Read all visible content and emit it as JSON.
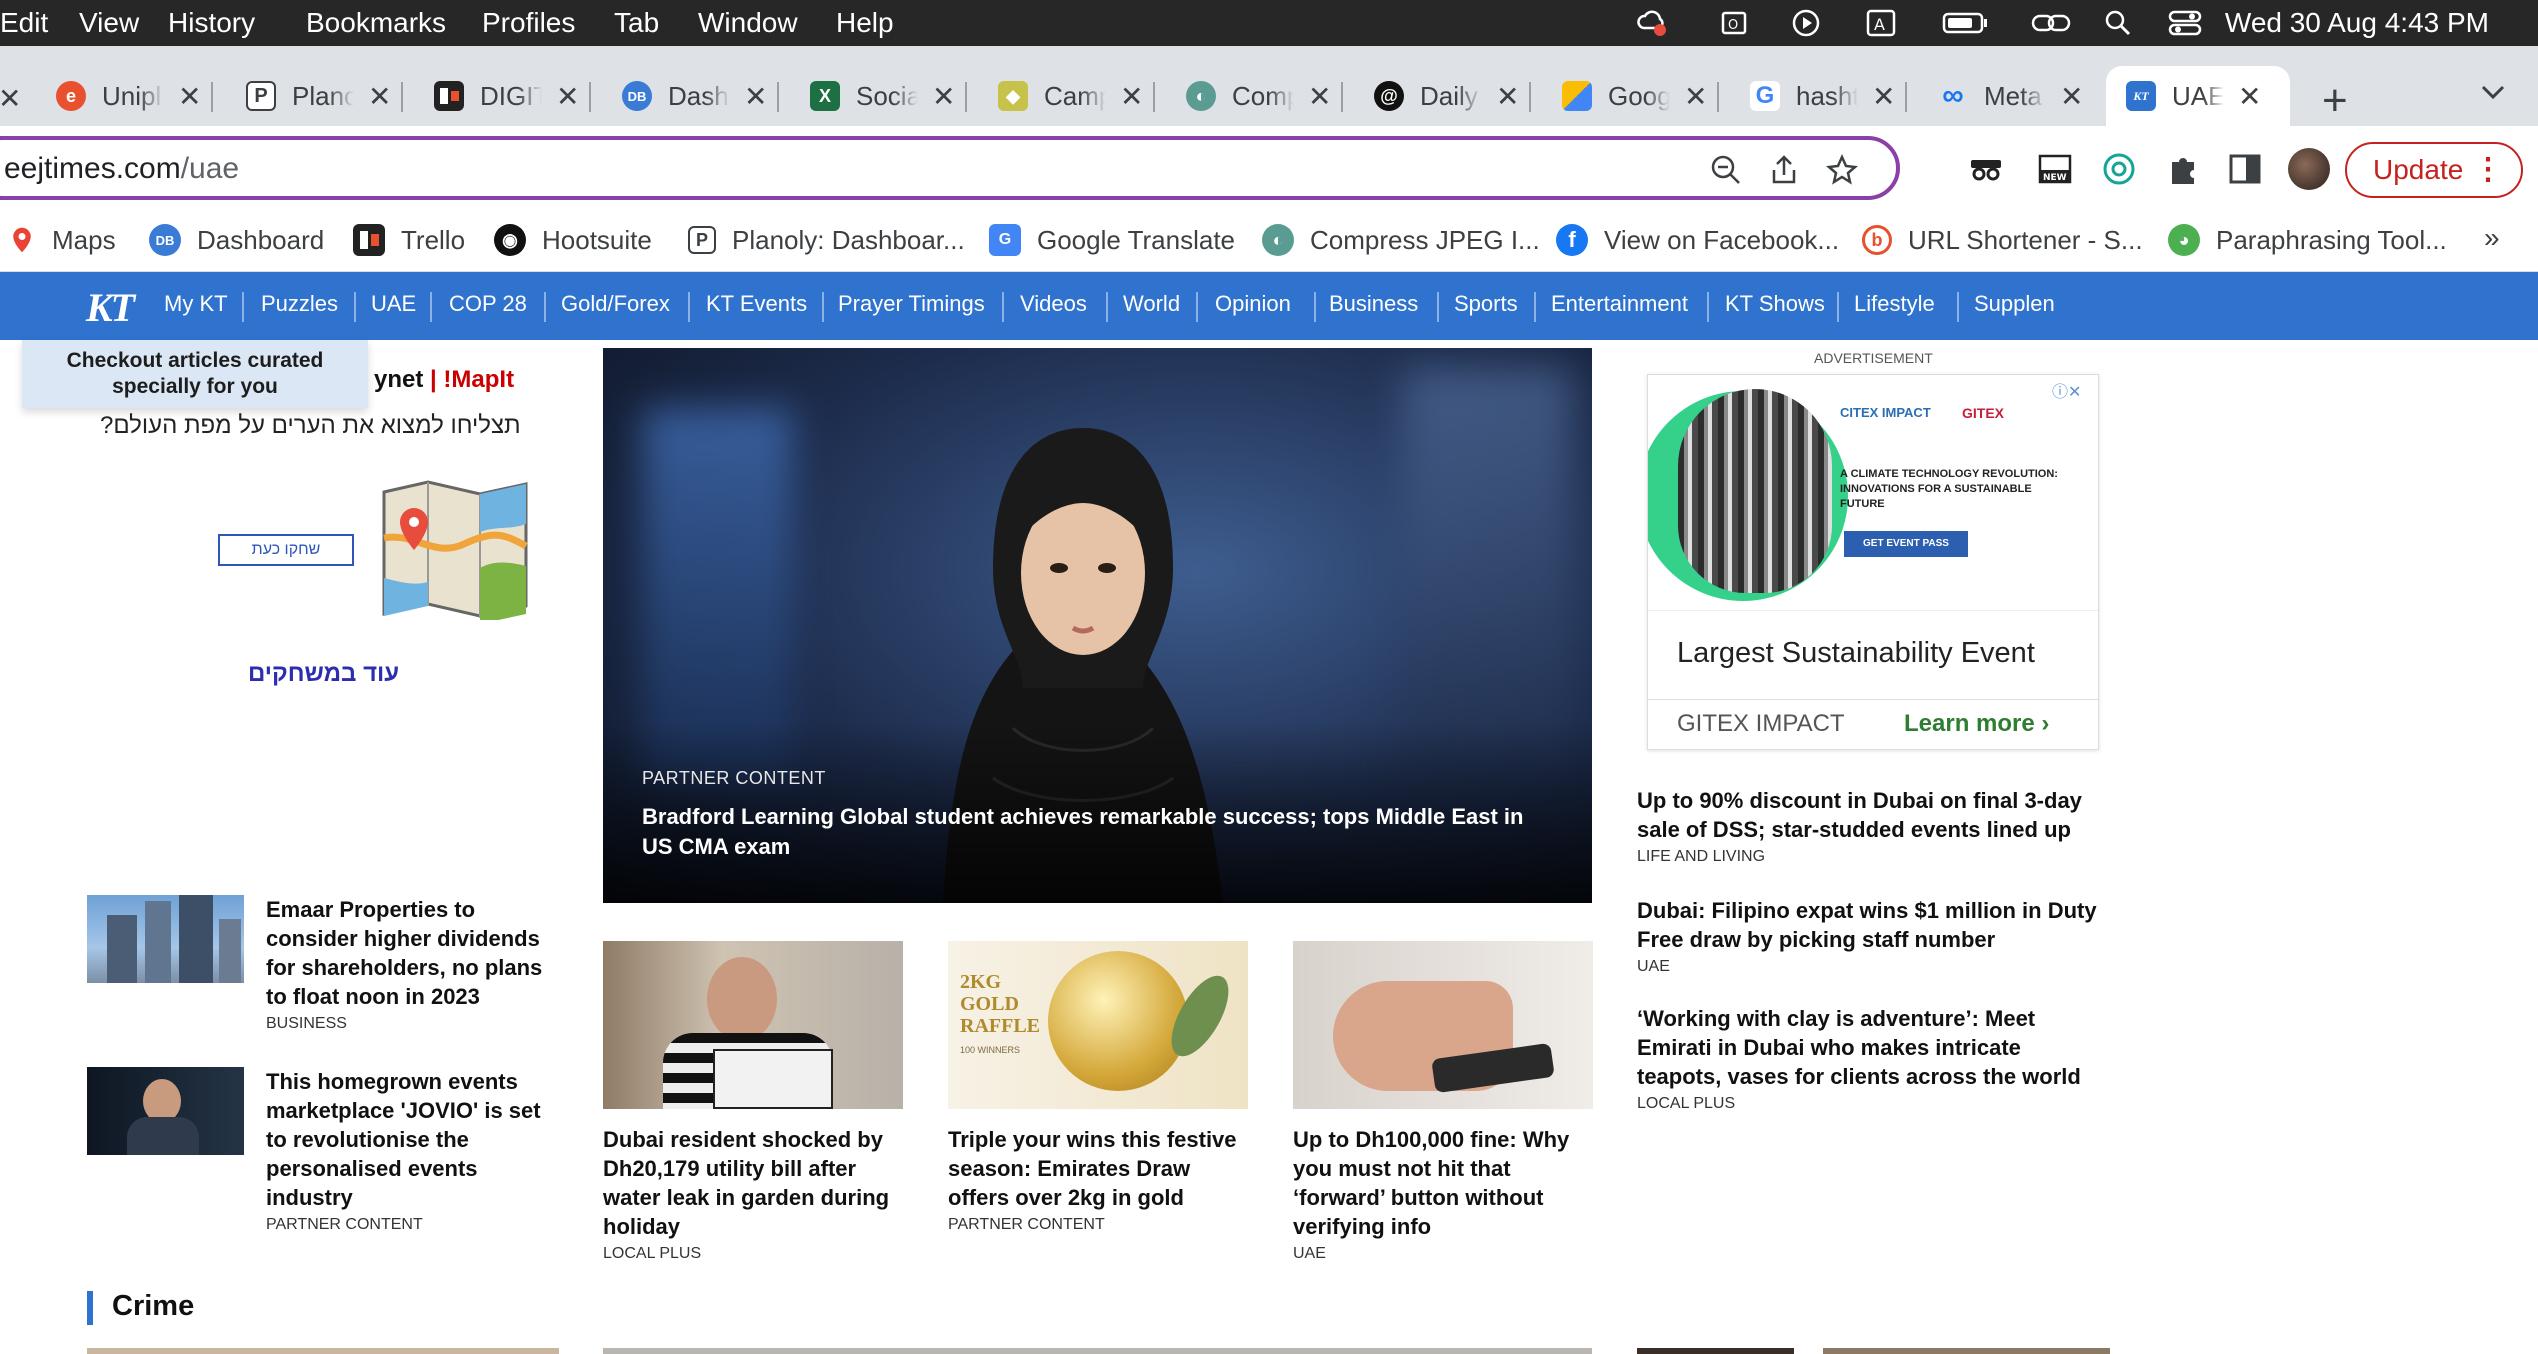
{
  "menubar": {
    "items": [
      "Edit",
      "View",
      "History",
      "Bookmarks",
      "Profiles",
      "Tab",
      "Window",
      "Help"
    ],
    "clock": "Wed 30 Aug  4:43 PM"
  },
  "tabs": [
    {
      "title": "Unipl",
      "icon": "unipile-icon",
      "color": "#e8502e",
      "glyph": "e"
    },
    {
      "title": "Plano",
      "icon": "planoly-icon",
      "color": "#ffffff",
      "glyph": "P"
    },
    {
      "title": "DIGIT",
      "icon": "trello-icon",
      "color": "#222222",
      "glyph": "▮"
    },
    {
      "title": "Dash",
      "icon": "dashboard-icon",
      "color": "#3a7bd5",
      "glyph": "DB"
    },
    {
      "title": "Socia",
      "icon": "excel-icon",
      "color": "#1d7044",
      "glyph": "X"
    },
    {
      "title": "Camp",
      "icon": "campaign-icon",
      "color": "#c7c24a",
      "glyph": "◆"
    },
    {
      "title": "Comp",
      "icon": "compress-icon",
      "color": "#5b9c92",
      "glyph": "◐"
    },
    {
      "title": "Daily",
      "icon": "threads-icon",
      "color": "#111111",
      "glyph": "@"
    },
    {
      "title": "Goog",
      "icon": "google-ads-icon",
      "color": "#4285f4",
      "glyph": "▲"
    },
    {
      "title": "hasht",
      "icon": "google-icon",
      "color": "#ffffff",
      "glyph": "G"
    },
    {
      "title": "Meta",
      "icon": "meta-icon",
      "color": "#ffffff",
      "glyph": "∞"
    },
    {
      "title": "UAE",
      "icon": "khaleej-times-icon",
      "color": "#2f73cf",
      "glyph": "KT"
    }
  ],
  "toolbar": {
    "url_host": "eejtimes.com",
    "url_path": "/uae",
    "update_label": "Update"
  },
  "bookmarks": [
    {
      "label": "Maps",
      "icon": "maps-icon"
    },
    {
      "label": "Dashboard",
      "icon": "dashboard-icon"
    },
    {
      "label": "Trello",
      "icon": "trello-icon"
    },
    {
      "label": "Hootsuite",
      "icon": "hootsuite-icon"
    },
    {
      "label": "Planoly: Dashboar...",
      "icon": "planoly-icon"
    },
    {
      "label": "Google Translate",
      "icon": "google-translate-icon"
    },
    {
      "label": "Compress JPEG I...",
      "icon": "compress-icon"
    },
    {
      "label": "View on Facebook...",
      "icon": "facebook-icon"
    },
    {
      "label": "URL Shortener - S...",
      "icon": "url-shortener-icon"
    },
    {
      "label": "Paraphrasing Tool...",
      "icon": "paraphrasing-tool-icon"
    }
  ],
  "site": {
    "logo": "KT",
    "nav": [
      "My KT",
      "Puzzles",
      "UAE",
      "COP 28",
      "Gold/Forex",
      "KT Events",
      "Prayer Timings",
      "Videos",
      "World",
      "Opinion",
      "Business",
      "Sports",
      "Entertainment",
      "KT Shows",
      "Lifestyle",
      "Supplen"
    ],
    "tooltip": "Checkout articles curated specially for you"
  },
  "left_ad": {
    "brand": "ynet",
    "brand_sep": "|",
    "brand_game": "!MapIt",
    "question": "תצליחו למצוא את הערים על מפת העולם?",
    "play_label": "שחקו כעת",
    "more_games": "עוד במשחקים"
  },
  "hero": {
    "kicker": "PARTNER CONTENT",
    "headline": "Bradford Learning Global student achieves remarkable success; tops Middle East in US CMA exam"
  },
  "left_stories": [
    {
      "headline": "Emaar Properties to consider higher dividends for shareholders, no plans to float noon in 2023",
      "category": "BUSINESS"
    },
    {
      "headline": "This homegrown events marketplace 'JOVIO' is set to revolutionise the personalised events industry",
      "category": "PARTNER CONTENT"
    }
  ],
  "cards": [
    {
      "headline": "Dubai resident shocked by Dh20,179 utility bill after water leak in garden during holiday",
      "category": "LOCAL PLUS"
    },
    {
      "headline": "Triple your wins this festive season: Emirates Draw offers over 2kg in gold",
      "category": "PARTNER CONTENT",
      "img_text": "2KG GOLD RAFFLE",
      "img_sub": "100 WINNERS"
    },
    {
      "headline": "Up to Dh100,000 fine: Why you must not hit that ‘forward’ button without verifying info",
      "category": "UAE"
    }
  ],
  "right_ad": {
    "label": "ADVERTISEMENT",
    "img_brand_a": "CITEX IMPACT",
    "img_brand_b": "GITEX",
    "img_tagline": "A CLIMATE TECHNOLOGY REVOLUTION: INNOVATIONS FOR A SUSTAINABLE FUTURE",
    "img_cta": "GET EVENT PASS",
    "title": "Largest Sustainability Event",
    "brand": "GITEX IMPACT",
    "cta": "Learn more"
  },
  "right_stories": [
    {
      "headline": "Up to 90% discount in Dubai on final 3-day sale of DSS; star-studded events lined up",
      "category": "LIFE AND LIVING"
    },
    {
      "headline": "Dubai: Filipino expat wins $1 million in Duty Free draw by picking staff number",
      "category": "UAE"
    },
    {
      "headline": "‘Working with clay is adventure’: Meet Emirati in Dubai who makes intricate teapots, vases for clients across the world",
      "category": "LOCAL PLUS"
    }
  ],
  "section": {
    "title": "Crime"
  },
  "colors": {
    "nav_blue": "#2f73cf",
    "update_red": "#c5221f",
    "learn_green": "#2e7d32",
    "omnibox_purple": "#8b3fa8"
  }
}
